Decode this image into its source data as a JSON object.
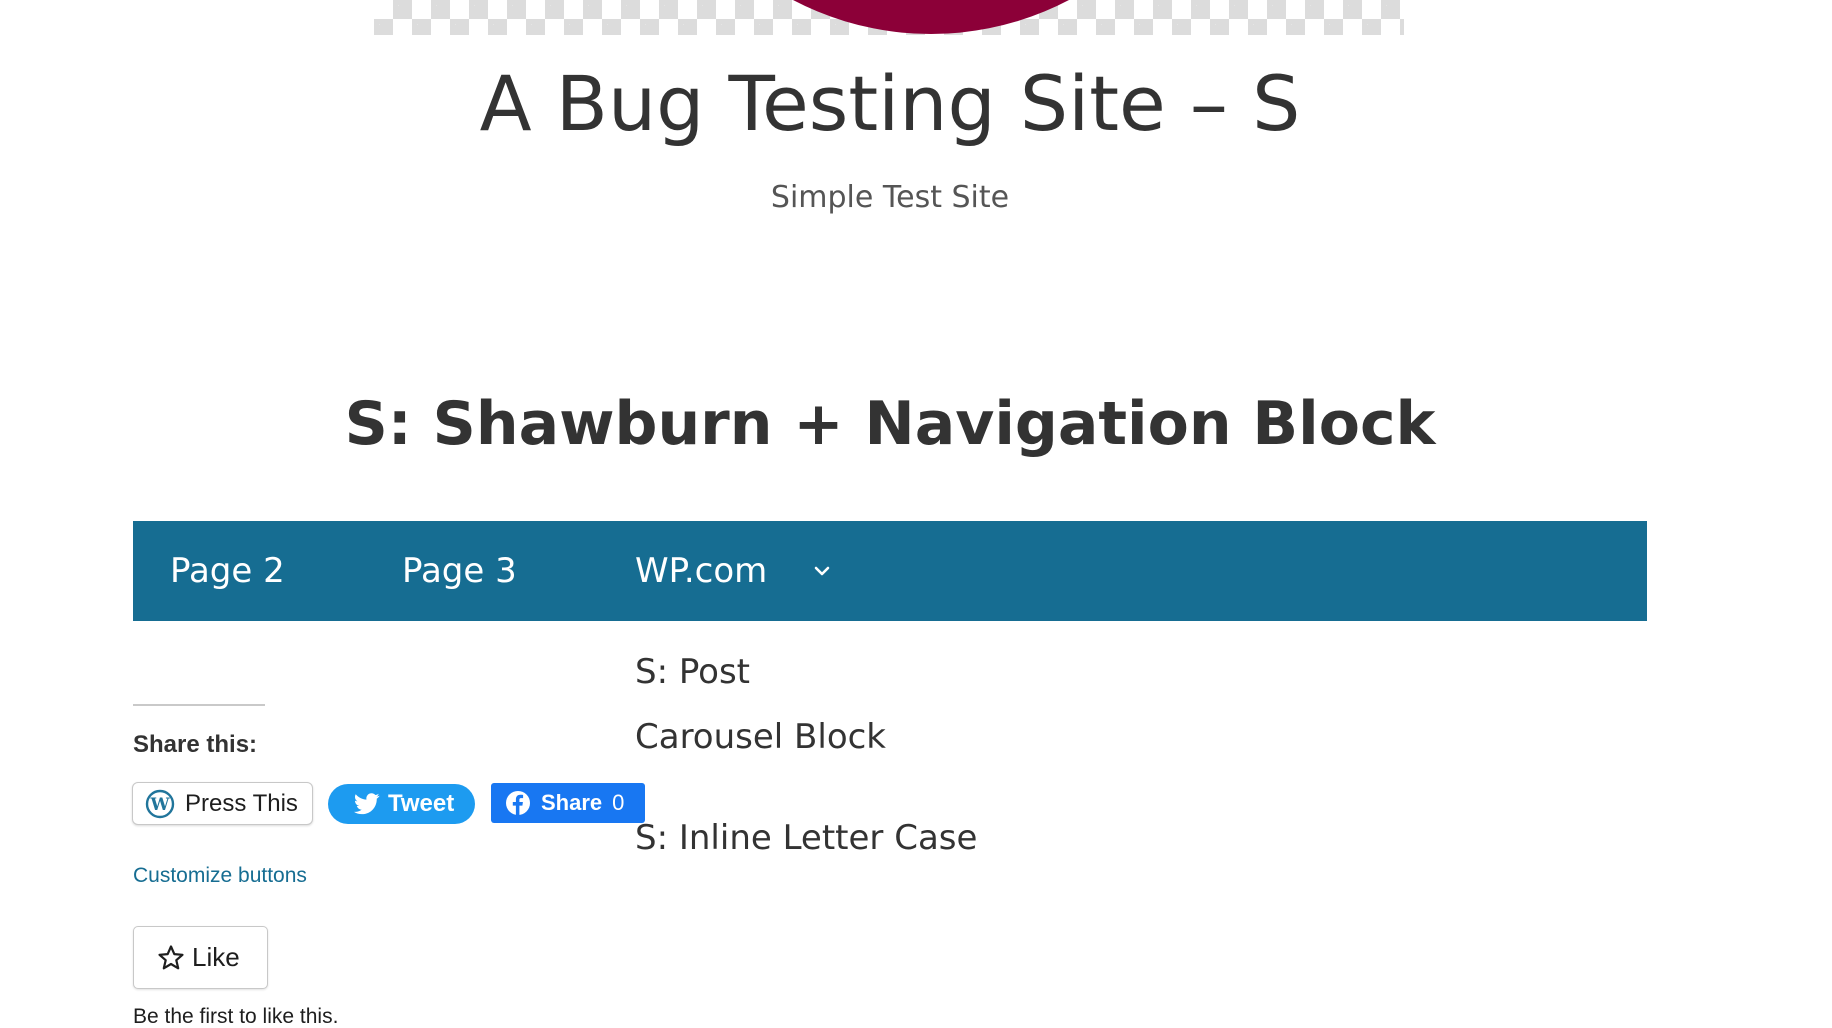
{
  "header": {
    "site_title": "A Bug Testing Site – S",
    "tagline": "Simple Test Site"
  },
  "page": {
    "heading": "S: Shawburn + Navigation Block"
  },
  "navigation": {
    "background_color": "#166d92",
    "items": [
      {
        "label": "Page 2"
      },
      {
        "label": "Page 3"
      },
      {
        "label": "WP.com",
        "icon": "chevron-down-icon"
      }
    ],
    "submenu": [
      {
        "label": "S: Post"
      },
      {
        "label": "Carousel Block"
      },
      {
        "label": "S: Inline Letter Case"
      }
    ]
  },
  "sharing": {
    "title": "Share this:",
    "buttons": {
      "press_this": {
        "label": "Press This",
        "icon": "wordpress-icon"
      },
      "tweet": {
        "label": "Tweet",
        "icon": "twitter-icon",
        "color": "#1d9bf0"
      },
      "facebook": {
        "label": "Share",
        "count": "0",
        "icon": "facebook-icon",
        "color": "#1877f2"
      }
    },
    "customize_label": "Customize buttons"
  },
  "likes": {
    "button_label": "Like",
    "icon": "star-icon",
    "note": "Be the first to like this."
  }
}
